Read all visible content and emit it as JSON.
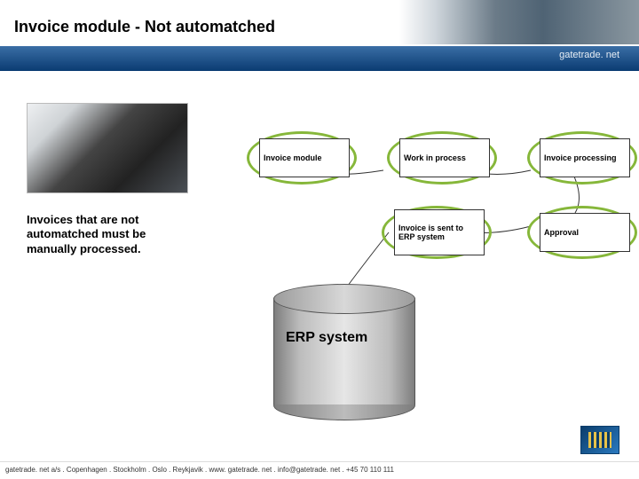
{
  "title": "Invoice module - Not automatched",
  "brand": "gatetrade. net",
  "explain": "Invoices that are not automatched must be manually processed.",
  "steps": {
    "s1": "Invoice module",
    "s2": "Work in process",
    "s3": "Invoice processing",
    "s4": "Invoice is sent to ERP system",
    "s5": "Approval"
  },
  "cylinder": "ERP system",
  "footer": "gatetrade. net a/s . Copenhagen . Stockholm . Oslo . Reykjavik . www. gatetrade. net . info@gatetrade. net . +45 70 110 111"
}
